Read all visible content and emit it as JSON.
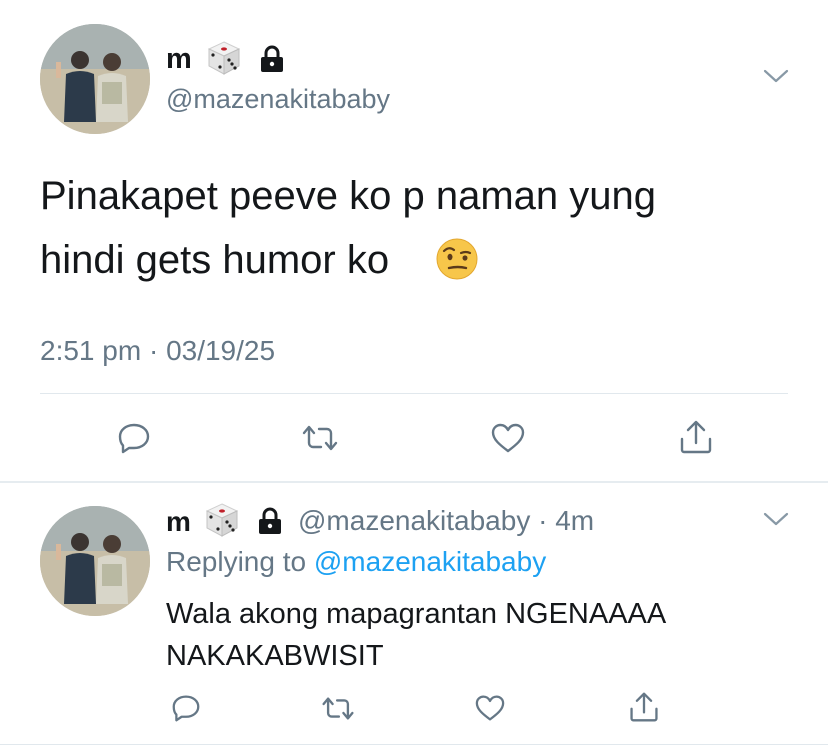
{
  "main_tweet": {
    "display_name": "m",
    "handle": "@mazenakitababy",
    "text_line1": "Pinakapet peeve ko p naman yung",
    "text_line2": "hindi gets humor ko",
    "time": "2:51 pm",
    "dot": "·",
    "date": "03/19/25"
  },
  "reply": {
    "display_name": "m",
    "handle": "@mazenakitababy",
    "dot": "·",
    "age": "4m",
    "replying_label": "Replying to",
    "replying_handle": "@mazenakitababy",
    "text_line1": "Wala akong mapagrantan NGENAAAA",
    "text_line2": "NAKAKABWISIT"
  },
  "icons": {
    "dice": "dice-emoji",
    "lock": "lock-icon",
    "raised_eyebrow": "face-with-raised-eyebrow-emoji",
    "chevron": "chevron-down-icon",
    "reply": "reply-icon",
    "retweet": "retweet-icon",
    "like": "heart-icon",
    "share": "share-icon"
  },
  "colors": {
    "text": "#14171a",
    "secondary": "#657786",
    "link": "#1da1f2",
    "divider": "#e1e8ed"
  }
}
